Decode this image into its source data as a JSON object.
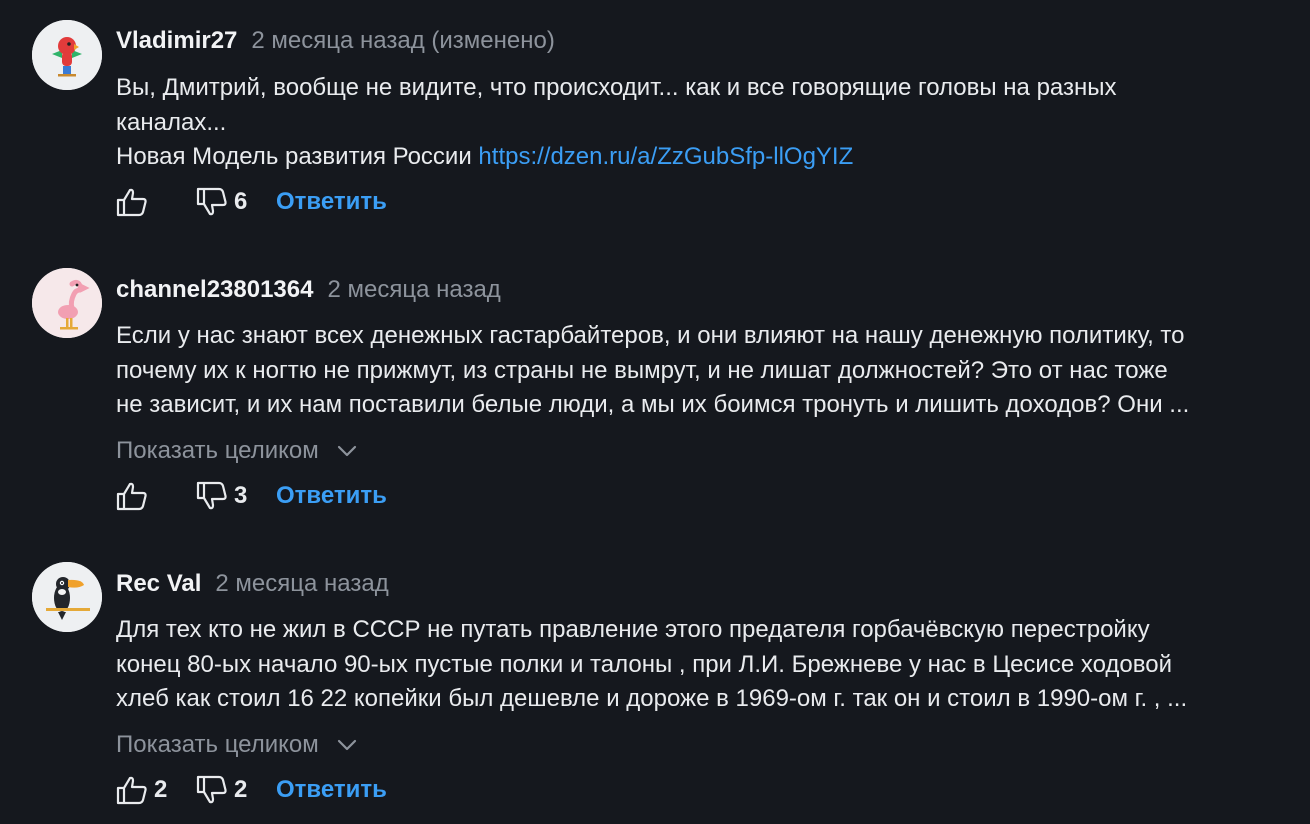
{
  "comments": [
    {
      "author": "Vladimir27",
      "time": "2 месяца назад (изменено)",
      "avatar_icon": "parrot-avatar-icon",
      "lines": [
        "Вы, Дмитрий, вообще не видите, что происходит... как и все говорящие головы на разных",
        "каналах..."
      ],
      "link_prefix": "Новая Модель развития России ",
      "link": "https://dzen.ru/a/ZzGubSfp-llOgYIZ",
      "likes": "",
      "dislikes": "6",
      "reply_label": "Ответить"
    },
    {
      "author": "channel23801364",
      "time": "2 месяца назад",
      "avatar_icon": "flamingo-avatar-icon",
      "lines": [
        "Если у нас знают всех денежных гастарбайтеров, и они влияют на нашу денежную политику, то",
        "почему их к ногтю не прижмут, из страны не вымрут, и не лишат должностей? Это от нас тоже",
        "не зависит, и их нам поставили белые люди, а мы их боимся тронуть и лишить доходов? Они ..."
      ],
      "expand_label": "Показать целиком",
      "likes": "",
      "dislikes": "3",
      "reply_label": "Ответить"
    },
    {
      "author": "Rec Val",
      "time": "2 месяца назад",
      "avatar_icon": "toucan-avatar-icon",
      "lines": [
        "Для тех кто не жил в СССР не путать правление этого предателя горбачёвскую перестройку",
        "конец 80-ых начало 90-ых пустые полки и талоны , при Л.И. Брежневе у нас в Цесисе ходовой",
        "хлеб как стоил 16 22 копейки был дешевле и дороже в 1969-ом г. так он и стоил в 1990-ом г. , ..."
      ],
      "expand_label": "Показать целиком",
      "likes": "2",
      "dislikes": "2",
      "reply_label": "Ответить"
    }
  ],
  "colors": {
    "background": "#15181e",
    "link": "#3b9ef5",
    "muted": "#8d939c"
  }
}
